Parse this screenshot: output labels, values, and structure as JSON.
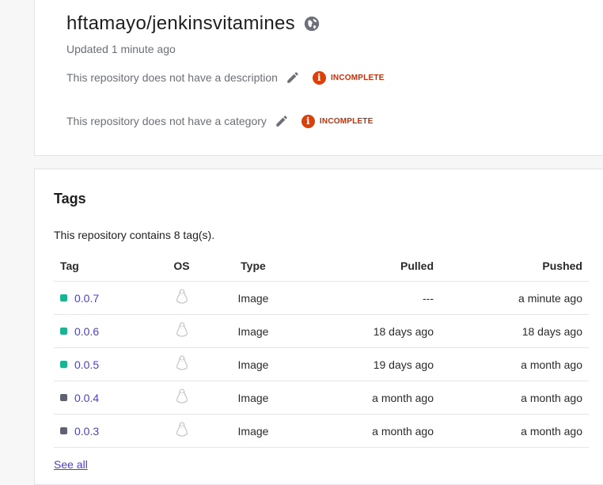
{
  "repo": {
    "name": "hftamayo/jenkinsvitamines",
    "updated": "Updated 1 minute ago",
    "description_text": "This repository does not have a description",
    "category_text": "This repository does not have a category",
    "incomplete_label": "INCOMPLETE"
  },
  "tags": {
    "title": "Tags",
    "count_text": "This repository contains 8 tag(s).",
    "headers": {
      "tag": "Tag",
      "os": "OS",
      "type": "Type",
      "pulled": "Pulled",
      "pushed": "Pushed"
    },
    "rows": [
      {
        "tag": "0.0.7",
        "type": "Image",
        "pulled": "---",
        "pushed": "a minute ago",
        "status_color": "#1ab394"
      },
      {
        "tag": "0.0.6",
        "type": "Image",
        "pulled": "18 days ago",
        "pushed": "18 days ago",
        "status_color": "#1ab394"
      },
      {
        "tag": "0.0.5",
        "type": "Image",
        "pulled": "19 days ago",
        "pushed": "a month ago",
        "status_color": "#1ab394"
      },
      {
        "tag": "0.0.4",
        "type": "Image",
        "pulled": "a month ago",
        "pushed": "a month ago",
        "status_color": "#5f6270"
      },
      {
        "tag": "0.0.3",
        "type": "Image",
        "pulled": "a month ago",
        "pushed": "a month ago",
        "status_color": "#5f6270"
      }
    ],
    "see_all": "See all"
  },
  "icons": {
    "visibility": "globe-icon",
    "edit": "pencil-icon",
    "warning": "info-icon",
    "os": "linux-icon"
  },
  "colors": {
    "link": "#4a3fd0",
    "incomplete": "#c0310e",
    "active_tag": "#1ab394",
    "stale_tag": "#5f6270"
  }
}
